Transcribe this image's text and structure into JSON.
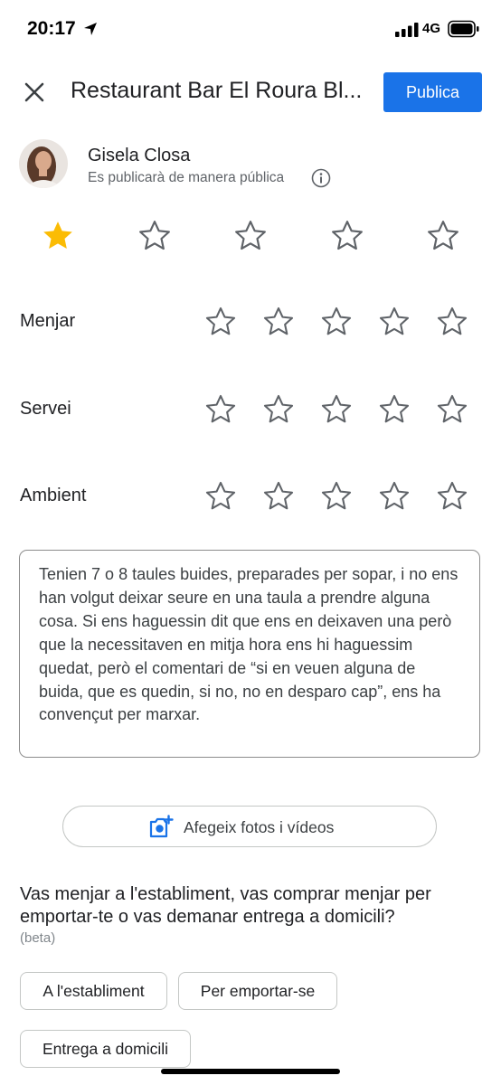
{
  "status_bar": {
    "time": "20:17",
    "network": "4G"
  },
  "header": {
    "title": "Restaurant Bar El Roura Bl...",
    "publish_label": "Publica"
  },
  "user": {
    "name": "Gisela Closa",
    "visibility": "Es publicarà de manera pública"
  },
  "overall_rating": {
    "value": 1,
    "max": 5
  },
  "categories": [
    {
      "label": "Menjar",
      "rating": 0
    },
    {
      "label": "Servei",
      "rating": 0
    },
    {
      "label": "Ambient",
      "rating": 0
    }
  ],
  "review": {
    "text": "Tenien 7 o 8 taules buides, preparades per sopar, i no ens han volgut deixar seure en una taula a prendre alguna cosa. Si ens haguessin dit que ens en deixaven una però que la necessitaven en mitja hora ens hi haguessim quedat, però el comentari de “si en veuen alguna de buida, que es quedin, si no, no en desparo cap”, ens ha convençut per marxar."
  },
  "add_photos": {
    "label": "Afegeix fotos i vídeos"
  },
  "question": {
    "text": "Vas menjar a l'establiment, vas comprar menjar per emportar-te o vas demanar entrega a domicili?",
    "note": "(beta)",
    "options": [
      "A l'establiment",
      "Per emportar-se",
      "Entrega a domicili"
    ]
  },
  "colors": {
    "accent": "#1a73e8",
    "star_filled": "#fbbc04",
    "star_outline": "#5f6368"
  }
}
